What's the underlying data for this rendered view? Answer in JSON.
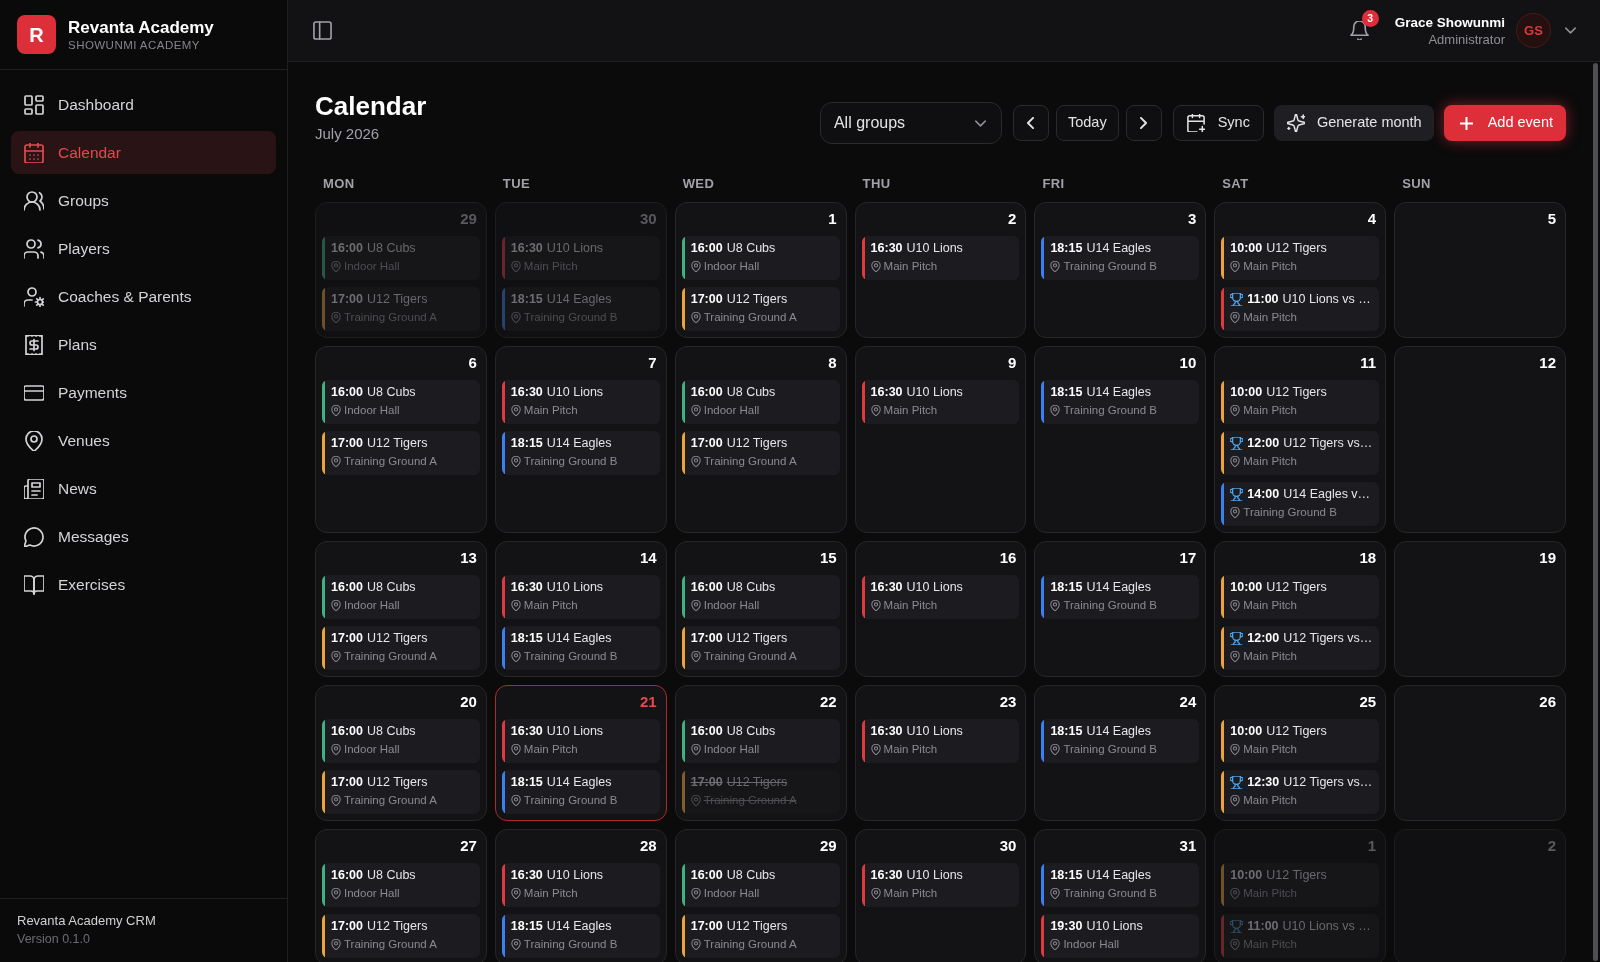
{
  "sidebar": {
    "brand": {
      "logo_letter": "R",
      "name": "Revanta Academy",
      "subtitle": "SHOWUNMI ACADEMY"
    },
    "items": [
      {
        "label": "Dashboard",
        "selected": false
      },
      {
        "label": "Calendar",
        "selected": true
      },
      {
        "label": "Groups",
        "selected": false
      },
      {
        "label": "Players",
        "selected": false
      },
      {
        "label": "Coaches & Parents",
        "selected": false
      },
      {
        "label": "Plans",
        "selected": false
      },
      {
        "label": "Payments",
        "selected": false
      },
      {
        "label": "Venues",
        "selected": false
      },
      {
        "label": "News",
        "selected": false
      },
      {
        "label": "Messages",
        "selected": false
      },
      {
        "label": "Exercises",
        "selected": false
      }
    ],
    "footer": {
      "product": "Revanta Academy CRM",
      "version": "Version 0.1.0"
    }
  },
  "header": {
    "notification_count": "3",
    "user": {
      "name": "Grace Showunmi",
      "role": "Administrator",
      "initials": "GS"
    }
  },
  "page": {
    "title": "Calendar",
    "subtitle": "July 2026"
  },
  "toolbar": {
    "group_select": "All groups",
    "today": "Today",
    "sync": "Sync",
    "generate": "Generate month",
    "add": "Add event"
  },
  "calendar": {
    "weekdays": [
      "MON",
      "TUE",
      "WED",
      "THU",
      "FRI",
      "SAT",
      "SUN"
    ],
    "weeks": [
      [
        {
          "number": "29",
          "outside_month": true,
          "today": false,
          "events": [
            {
              "time": "16:00",
              "title": "U8 Cubs",
              "location": "Indoor Hall",
              "color": "#295744",
              "kind": "training",
              "cancelled": false
            },
            {
              "time": "17:00",
              "title": "U12 Tigers",
              "location": "Training Ground A",
              "color": "#6e5029",
              "kind": "training",
              "cancelled": false
            }
          ]
        },
        {
          "number": "30",
          "outside_month": true,
          "today": false,
          "events": [
            {
              "time": "16:30",
              "title": "U10 Lions",
              "location": "Main Pitch",
              "color": "#69262a",
              "kind": "training",
              "cancelled": false
            },
            {
              "time": "18:15",
              "title": "U14 Eagles",
              "location": "Training Ground B",
              "color": "#274271",
              "kind": "training",
              "cancelled": false
            }
          ]
        },
        {
          "number": "1",
          "outside_month": false,
          "today": false,
          "events": [
            {
              "time": "16:00",
              "title": "U8 Cubs",
              "location": "Indoor Hall",
              "color": "#3fb37f",
              "kind": "training",
              "cancelled": false
            },
            {
              "time": "17:00",
              "title": "U12 Tigers",
              "location": "Training Ground A",
              "color": "#eda23a",
              "kind": "training",
              "cancelled": false
            }
          ]
        },
        {
          "number": "2",
          "outside_month": false,
          "today": false,
          "events": [
            {
              "time": "16:30",
              "title": "U10 Lions",
              "location": "Main Pitch",
              "color": "#e0393e",
              "kind": "training",
              "cancelled": false
            }
          ]
        },
        {
          "number": "3",
          "outside_month": false,
          "today": false,
          "events": [
            {
              "time": "18:15",
              "title": "U14 Eagles",
              "location": "Training Ground B",
              "color": "#3b7ff0",
              "kind": "training",
              "cancelled": false
            }
          ]
        },
        {
          "number": "4",
          "outside_month": false,
          "today": false,
          "events": [
            {
              "time": "10:00",
              "title": "U12 Tigers",
              "location": "Main Pitch",
              "color": "#eda23a",
              "kind": "training",
              "cancelled": false
            },
            {
              "time": "11:00",
              "title": "U10 Lions vs …",
              "location": "Main Pitch",
              "color": "#e0393e",
              "kind": "match",
              "cancelled": false
            }
          ]
        },
        {
          "number": "5",
          "outside_month": false,
          "today": false
        }
      ],
      [
        {
          "number": "6",
          "outside_month": false,
          "today": false,
          "events": [
            {
              "time": "16:00",
              "title": "U8 Cubs",
              "location": "Indoor Hall",
              "color": "#3fb37f",
              "kind": "training",
              "cancelled": false
            },
            {
              "time": "17:00",
              "title": "U12 Tigers",
              "location": "Training Ground A",
              "color": "#eda23a",
              "kind": "training",
              "cancelled": false
            }
          ]
        },
        {
          "number": "7",
          "outside_month": false,
          "today": false,
          "events": [
            {
              "time": "16:30",
              "title": "U10 Lions",
              "location": "Main Pitch",
              "color": "#e0393e",
              "kind": "training",
              "cancelled": false
            },
            {
              "time": "18:15",
              "title": "U14 Eagles",
              "location": "Training Ground B",
              "color": "#3b7ff0",
              "kind": "training",
              "cancelled": false
            }
          ]
        },
        {
          "number": "8",
          "outside_month": false,
          "today": false,
          "events": [
            {
              "time": "16:00",
              "title": "U8 Cubs",
              "location": "Indoor Hall",
              "color": "#3fb37f",
              "kind": "training",
              "cancelled": false
            },
            {
              "time": "17:00",
              "title": "U12 Tigers",
              "location": "Training Ground A",
              "color": "#eda23a",
              "kind": "training",
              "cancelled": false
            }
          ]
        },
        {
          "number": "9",
          "outside_month": false,
          "today": false,
          "events": [
            {
              "time": "16:30",
              "title": "U10 Lions",
              "location": "Main Pitch",
              "color": "#e0393e",
              "kind": "training",
              "cancelled": false
            }
          ]
        },
        {
          "number": "10",
          "outside_month": false,
          "today": false,
          "events": [
            {
              "time": "18:15",
              "title": "U14 Eagles",
              "location": "Training Ground B",
              "color": "#3b7ff0",
              "kind": "training",
              "cancelled": false
            }
          ]
        },
        {
          "number": "11",
          "outside_month": false,
          "today": false,
          "events": [
            {
              "time": "10:00",
              "title": "U12 Tigers",
              "location": "Main Pitch",
              "color": "#eda23a",
              "kind": "training",
              "cancelled": false
            },
            {
              "time": "12:00",
              "title": "U12 Tigers vs…",
              "location": "Main Pitch",
              "color": "#eda23a",
              "kind": "match",
              "cancelled": false
            },
            {
              "time": "14:00",
              "title": "U14 Eagles v…",
              "location": "Training Ground B",
              "color": "#3b7ff0",
              "kind": "match",
              "cancelled": false
            }
          ]
        },
        {
          "number": "12",
          "outside_month": false,
          "today": false
        }
      ],
      [
        {
          "number": "13",
          "outside_month": false,
          "today": false,
          "events": [
            {
              "time": "16:00",
              "title": "U8 Cubs",
              "location": "Indoor Hall",
              "color": "#3fb37f",
              "kind": "training",
              "cancelled": false
            },
            {
              "time": "17:00",
              "title": "U12 Tigers",
              "location": "Training Ground A",
              "color": "#eda23a",
              "kind": "training",
              "cancelled": false
            }
          ]
        },
        {
          "number": "14",
          "outside_month": false,
          "today": false,
          "events": [
            {
              "time": "16:30",
              "title": "U10 Lions",
              "location": "Main Pitch",
              "color": "#e0393e",
              "kind": "training",
              "cancelled": false
            },
            {
              "time": "18:15",
              "title": "U14 Eagles",
              "location": "Training Ground B",
              "color": "#3b7ff0",
              "kind": "training",
              "cancelled": false
            }
          ]
        },
        {
          "number": "15",
          "outside_month": false,
          "today": false,
          "events": [
            {
              "time": "16:00",
              "title": "U8 Cubs",
              "location": "Indoor Hall",
              "color": "#3fb37f",
              "kind": "training",
              "cancelled": false
            },
            {
              "time": "17:00",
              "title": "U12 Tigers",
              "location": "Training Ground A",
              "color": "#eda23a",
              "kind": "training",
              "cancelled": false
            }
          ]
        },
        {
          "number": "16",
          "outside_month": false,
          "today": false,
          "events": [
            {
              "time": "16:30",
              "title": "U10 Lions",
              "location": "Main Pitch",
              "color": "#e0393e",
              "kind": "training",
              "cancelled": false
            }
          ]
        },
        {
          "number": "17",
          "outside_month": false,
          "today": false,
          "events": [
            {
              "time": "18:15",
              "title": "U14 Eagles",
              "location": "Training Ground B",
              "color": "#3b7ff0",
              "kind": "training",
              "cancelled": false
            }
          ]
        },
        {
          "number": "18",
          "outside_month": false,
          "today": false,
          "events": [
            {
              "time": "10:00",
              "title": "U12 Tigers",
              "location": "Main Pitch",
              "color": "#eda23a",
              "kind": "training",
              "cancelled": false
            },
            {
              "time": "12:00",
              "title": "U12 Tigers vs…",
              "location": "Main Pitch",
              "color": "#eda23a",
              "kind": "match",
              "cancelled": false
            }
          ]
        },
        {
          "number": "19",
          "outside_month": false,
          "today": false
        }
      ],
      [
        {
          "number": "20",
          "outside_month": false,
          "today": false,
          "events": [
            {
              "time": "16:00",
              "title": "U8 Cubs",
              "location": "Indoor Hall",
              "color": "#3fb37f",
              "kind": "training",
              "cancelled": false
            },
            {
              "time": "17:00",
              "title": "U12 Tigers",
              "location": "Training Ground A",
              "color": "#eda23a",
              "kind": "training",
              "cancelled": false
            }
          ]
        },
        {
          "number": "21",
          "outside_month": false,
          "today": true,
          "events": [
            {
              "time": "16:30",
              "title": "U10 Lions",
              "location": "Main Pitch",
              "color": "#e0393e",
              "kind": "training",
              "cancelled": false
            },
            {
              "time": "18:15",
              "title": "U14 Eagles",
              "location": "Training Ground B",
              "color": "#3b7ff0",
              "kind": "training",
              "cancelled": false
            }
          ]
        },
        {
          "number": "22",
          "outside_month": false,
          "today": false,
          "events": [
            {
              "time": "16:00",
              "title": "U8 Cubs",
              "location": "Indoor Hall",
              "color": "#3fb37f",
              "kind": "training",
              "cancelled": false
            },
            {
              "time": "17:00",
              "title": "U12 Tigers",
              "location": "Training Ground A",
              "color": "#835e2b",
              "kind": "training",
              "cancelled": true
            }
          ]
        },
        {
          "number": "23",
          "outside_month": false,
          "today": false,
          "events": [
            {
              "time": "16:30",
              "title": "U10 Lions",
              "location": "Main Pitch",
              "color": "#e0393e",
              "kind": "training",
              "cancelled": false
            }
          ]
        },
        {
          "number": "24",
          "outside_month": false,
          "today": false,
          "events": [
            {
              "time": "18:15",
              "title": "U14 Eagles",
              "location": "Training Ground B",
              "color": "#3b7ff0",
              "kind": "training",
              "cancelled": false
            }
          ]
        },
        {
          "number": "25",
          "outside_month": false,
          "today": false,
          "events": [
            {
              "time": "10:00",
              "title": "U12 Tigers",
              "location": "Main Pitch",
              "color": "#eda23a",
              "kind": "training",
              "cancelled": false
            },
            {
              "time": "12:30",
              "title": "U12 Tigers vs…",
              "location": "Main Pitch",
              "color": "#eda23a",
              "kind": "match",
              "cancelled": false
            }
          ]
        },
        {
          "number": "26",
          "outside_month": false,
          "today": false
        }
      ],
      [
        {
          "number": "27",
          "outside_month": false,
          "today": false,
          "events": [
            {
              "time": "16:00",
              "title": "U8 Cubs",
              "location": "Indoor Hall",
              "color": "#3fb37f",
              "kind": "training",
              "cancelled": false
            },
            {
              "time": "17:00",
              "title": "U12 Tigers",
              "location": "Training Ground A",
              "color": "#eda23a",
              "kind": "training",
              "cancelled": false
            }
          ]
        },
        {
          "number": "28",
          "outside_month": false,
          "today": false,
          "events": [
            {
              "time": "16:30",
              "title": "U10 Lions",
              "location": "Main Pitch",
              "color": "#e0393e",
              "kind": "training",
              "cancelled": false
            },
            {
              "time": "18:15",
              "title": "U14 Eagles",
              "location": "Training Ground B",
              "color": "#3b7ff0",
              "kind": "training",
              "cancelled": false
            }
          ]
        },
        {
          "number": "29",
          "outside_month": false,
          "today": false,
          "events": [
            {
              "time": "16:00",
              "title": "U8 Cubs",
              "location": "Indoor Hall",
              "color": "#3fb37f",
              "kind": "training",
              "cancelled": false
            },
            {
              "time": "17:00",
              "title": "U12 Tigers",
              "location": "Training Ground A",
              "color": "#eda23a",
              "kind": "training",
              "cancelled": false
            }
          ]
        },
        {
          "number": "30",
          "outside_month": false,
          "today": false,
          "events": [
            {
              "time": "16:30",
              "title": "U10 Lions",
              "location": "Main Pitch",
              "color": "#e0393e",
              "kind": "training",
              "cancelled": false
            }
          ]
        },
        {
          "number": "31",
          "outside_month": false,
          "today": false,
          "events": [
            {
              "time": "18:15",
              "title": "U14 Eagles",
              "location": "Training Ground B",
              "color": "#3b7ff0",
              "kind": "training",
              "cancelled": false
            },
            {
              "time": "19:30",
              "title": "U10 Lions",
              "location": "Indoor Hall",
              "color": "#e0393e",
              "kind": "training",
              "cancelled": false
            }
          ]
        },
        {
          "number": "1",
          "outside_month": true,
          "today": false,
          "events": [
            {
              "time": "10:00",
              "title": "U12 Tigers",
              "location": "Main Pitch",
              "color": "#6e5029",
              "kind": "training",
              "cancelled": false
            },
            {
              "time": "11:00",
              "title": "U10 Lions vs …",
              "location": "Main Pitch",
              "color": "#69262a",
              "kind": "match",
              "cancelled": false
            }
          ]
        },
        {
          "number": "2",
          "outside_month": true,
          "today": false
        }
      ]
    ]
  }
}
